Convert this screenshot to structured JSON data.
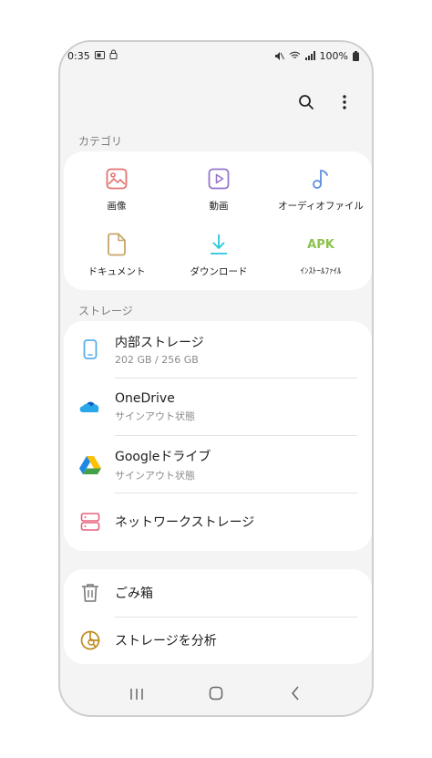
{
  "status": {
    "time": "0:35",
    "battery": "100%"
  },
  "sections": {
    "category_title": "カテゴリ",
    "storage_title": "ストレージ"
  },
  "categories": [
    {
      "label": "画像",
      "icon": "image-icon"
    },
    {
      "label": "動画",
      "icon": "video-icon"
    },
    {
      "label": "オーディオファイル",
      "icon": "audio-icon"
    },
    {
      "label": "ドキュメント",
      "icon": "document-icon"
    },
    {
      "label": "ダウンロード",
      "icon": "download-icon"
    },
    {
      "label": "ｲﾝｽﾄｰﾙﾌｧｲﾙ",
      "icon_text": "APK"
    }
  ],
  "storage": [
    {
      "title": "内部ストレージ",
      "subtitle": "202 GB / 256 GB",
      "icon": "phone-icon"
    },
    {
      "title": "OneDrive",
      "subtitle": "サインアウト状態",
      "icon": "onedrive-icon"
    },
    {
      "title": "Googleドライブ",
      "subtitle": "サインアウト状態",
      "icon": "google-drive-icon"
    },
    {
      "title": "ネットワークストレージ",
      "icon": "network-storage-icon"
    }
  ],
  "tools": [
    {
      "title": "ごみ箱",
      "icon": "trash-icon"
    },
    {
      "title": "ストレージを分析",
      "icon": "storage-analysis-icon"
    }
  ],
  "colors": {
    "background": "#f4f4f4",
    "card": "#ffffff",
    "image": "#e57373",
    "video": "#9575cd",
    "audio": "#5c8fe0",
    "document": "#c9a46a",
    "download": "#26c6da",
    "apk": "#8bc34a",
    "network": "#e8607c",
    "analysis": "#c08a1e"
  }
}
